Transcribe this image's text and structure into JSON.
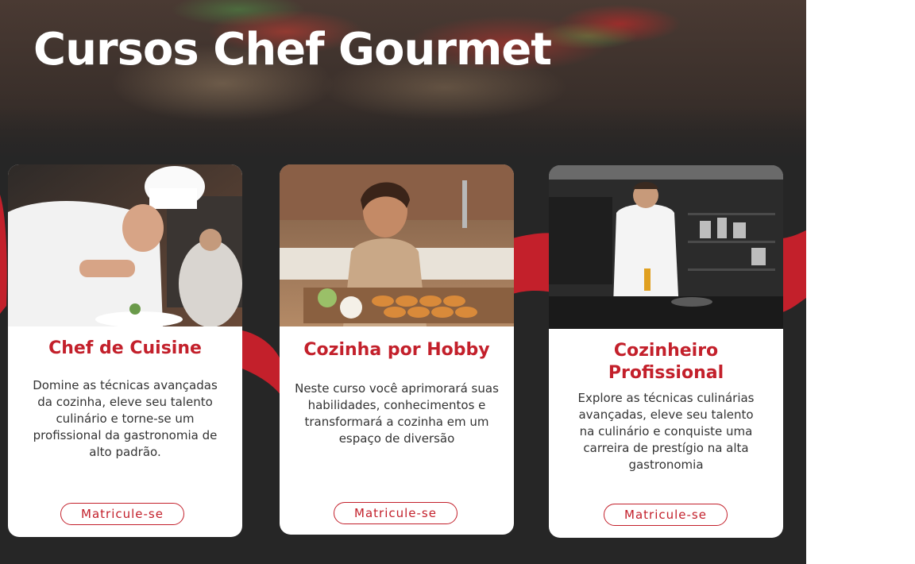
{
  "page": {
    "title": "Cursos Chef Gourmet"
  },
  "colors": {
    "accent": "#c3202b",
    "background": "#262626",
    "card": "#ffffff"
  },
  "courses": [
    {
      "title": "Chef de Cuisine",
      "description": "Domine as técnicas avançadas da cozinha, eleve seu talento culinário e torne-se um profissional da gastronomia de alto padrão.",
      "button_label": "Matricule-se",
      "image": "chef-plating-photo"
    },
    {
      "title": "Cozinha por Hobby",
      "description": "Neste curso você aprimorará suas habilidades, conhecimentos e transformará a cozinha em um espaço de diversão",
      "button_label": "Matricule-se",
      "image": "woman-preparing-appetizers-photo"
    },
    {
      "title": "Cozinheiro Profissional",
      "description": "Explore as técnicas culinárias avançadas, eleve seu talento na culinário e conquiste uma carreira de prestígio na alta gastronomia",
      "button_label": "Matricule-se",
      "image": "chef-in-kitchen-photo"
    }
  ]
}
